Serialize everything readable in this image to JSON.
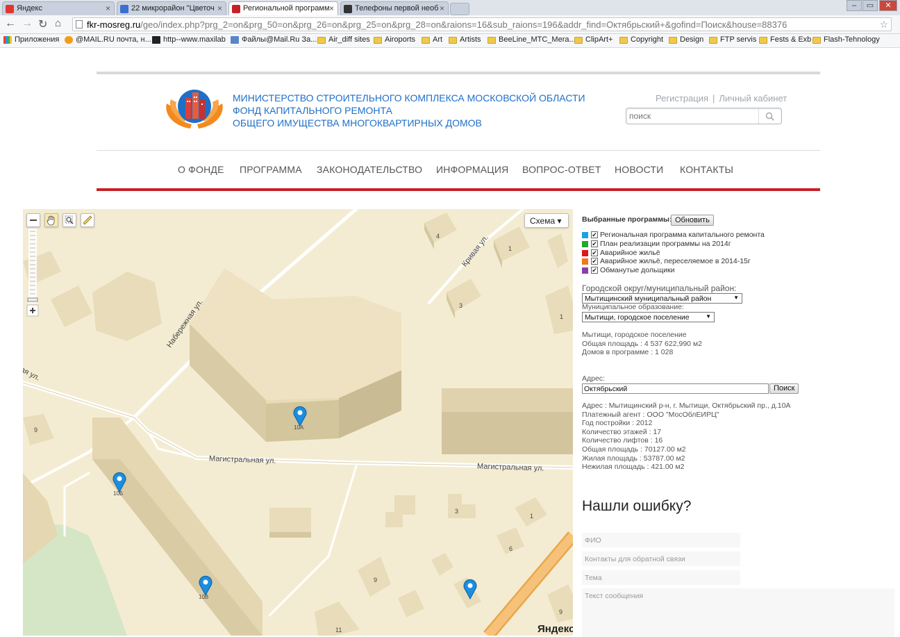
{
  "browser": {
    "tabs": [
      {
        "title": "Яндекс",
        "favicon_color": "#e3342f"
      },
      {
        "title": "22 микрорайон \"Цветоч",
        "favicon_color": "#3b6fd0"
      },
      {
        "title": "Региональной программ",
        "favicon_color": "#c62127"
      },
      {
        "title": "Телефоны первой необ",
        "favicon_color": "#333333"
      }
    ],
    "url_host": "fkr-mosreg.ru",
    "url_path": "/geo/index.php?prg_2=on&prg_50=on&prg_26=on&prg_25=on&prg_28=on&raions=16&sub_raions=196&addr_find=Октябрьский+&gofind=Поиск&house=88376",
    "bookmarks": [
      {
        "label": "Приложения",
        "icon": "apps-icon"
      },
      {
        "label": "@MAIL.RU почта, н...",
        "icon": "mailru-icon"
      },
      {
        "label": "http--www.maxilab",
        "icon": "maxilab-icon"
      },
      {
        "label": "Файлы@Mail.Ru За...",
        "icon": "files-icon"
      },
      {
        "label": "Air_diff sites",
        "icon": "folder-icon"
      },
      {
        "label": "Airoports",
        "icon": "folder-icon"
      },
      {
        "label": "Art",
        "icon": "folder-icon"
      },
      {
        "label": "Artists",
        "icon": "folder-icon"
      },
      {
        "label": "BeeLine_MTC_Mera...",
        "icon": "folder-icon"
      },
      {
        "label": "ClipArt+",
        "icon": "folder-icon"
      },
      {
        "label": "Copyright",
        "icon": "folder-icon"
      },
      {
        "label": "Design",
        "icon": "folder-icon"
      },
      {
        "label": "FTP servis",
        "icon": "folder-icon"
      },
      {
        "label": "Fests & Exb",
        "icon": "folder-icon"
      },
      {
        "label": "Flash-Tehnology",
        "icon": "folder-icon"
      }
    ]
  },
  "header": {
    "org_line1": "МИНИСТЕРСТВО СТРОИТЕЛЬНОГО КОМПЛЕКСА МОСКОВСКОЙ ОБЛАСТИ",
    "org_line2": "ФОНД КАПИТАЛЬНОГО РЕМОНТА",
    "org_line3": "ОБЩЕГО ИМУЩЕСТВА МНОГОКВАРТИРНЫХ ДОМОВ",
    "register": "Регистрация",
    "separator": "|",
    "cabinet": "Личный кабинет",
    "search_placeholder": "поиск",
    "brand_blue": "#1e6fc8",
    "brand_red": "#c62127"
  },
  "nav": [
    "О ФОНДЕ",
    "ПРОГРАММА",
    "ЗАКОНОДАТЕЛЬСТВО",
    "ИНФОРМАЦИЯ",
    "ВОПРОС-ОТВЕТ",
    "НОВОСТИ",
    "КОНТАКТЫ"
  ],
  "map": {
    "layer_button": "Схема ▾",
    "streets": {
      "naberezhnaya": "Набережная ул.",
      "krivaya": "Кривая ул.",
      "magistralnaya": "Магистральная ул.",
      "edge": "ая ул."
    },
    "house_numbers": [
      "4",
      "1",
      "3",
      "1",
      "9",
      "1",
      "3",
      "6",
      "9",
      "11",
      "9"
    ],
    "marker_labels": [
      "10А",
      "10Б",
      "10В"
    ],
    "copyright": "Яндекс",
    "marker_color": "#1a8ee0"
  },
  "panel": {
    "selected_programs": "Выбранные программы:",
    "refresh": "Обновить",
    "programs": [
      {
        "label": "Региональная программа капитального ремонта",
        "color": "#1aa0e6",
        "checked": true
      },
      {
        "label": "План реализации программы на 2014г",
        "color": "#22a82a",
        "checked": true
      },
      {
        "label": "Аварийное жильё",
        "color": "#e0151b",
        "checked": true
      },
      {
        "label": "Аварийное жильё, переселяемое в 2014-15г",
        "color": "#f07818",
        "checked": true
      },
      {
        "label": "Обманутые дольщики",
        "color": "#8a3ea8",
        "checked": true
      }
    ],
    "district_label": "Городской округ/муниципальный район:",
    "district_value": "Мытищинский муниципальный район",
    "municipality_label": "Муниципальное образование:",
    "municipality_value": "Мытищи, городское поселение",
    "stats": {
      "name": "Мытищи, городское поселение",
      "area": "Общая площадь : 4 537 622,990 м2",
      "houses": "Домов в программе : 1 028"
    },
    "address_label": "Адрес:",
    "address_value": "Октябрьский",
    "search_button": "Поиск",
    "details": [
      "Адрес : Мытищинский р-н, г. Мытищи, Октябрьский пр., д.10А",
      "Платежный агент : ООО \"МосОблЕИРЦ\"",
      "Год постройки : 2012",
      "Количество этажей : 17",
      "Количество лифтов : 16",
      "Общая площадь : 70127.00 м2",
      "Жилая площадь : 53787.00 м2",
      "Нежилая площадь : 421.00 м2"
    ],
    "feedback_title": "Нашли ошибку?",
    "feedback_fields": {
      "fio": "ФИО",
      "contacts": "Контакты для обратной связи",
      "topic": "Тема",
      "message": "Текст сообщения"
    }
  }
}
